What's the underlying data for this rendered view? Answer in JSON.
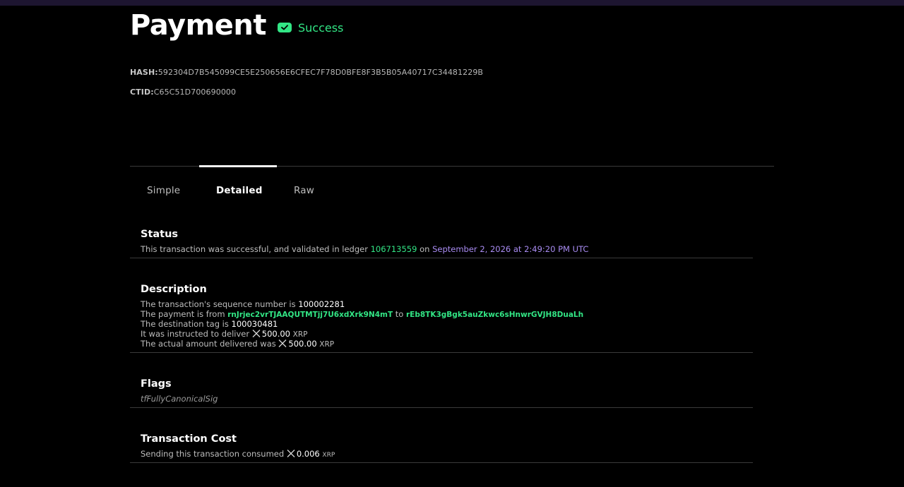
{
  "header": {
    "title": "Payment",
    "status": "Success",
    "hash_label": "HASH:",
    "hash_value": "592304D7B545099CE5E250656E6CFEC7F78D0BFE8F3B5B05A40717C34481229B",
    "ctid_label": "CTID:",
    "ctid_value": "C65C51D700690000"
  },
  "tabs": [
    {
      "label": "Simple",
      "active": false
    },
    {
      "label": "Detailed",
      "active": true
    },
    {
      "label": "Raw",
      "active": false
    }
  ],
  "status_section": {
    "title": "Status",
    "text_prefix": "This transaction was successful, and validated in ledger ",
    "ledger": "106713559",
    "text_mid": " on ",
    "date": "September 2, 2026 at 2:49:20 PM UTC"
  },
  "description_section": {
    "title": "Description",
    "line1_prefix": "The transaction's sequence number is ",
    "sequence": "100002281",
    "line2_prefix": "The payment is from ",
    "from_account": "rnJrjec2vrTJAAQUTMTjj7U6xdXrk9N4mT",
    "line2_mid": " to ",
    "to_account": "rEb8TK3gBgk5auZkwc6sHnwrGVJH8DuaLh",
    "line3_prefix": "The destination tag is ",
    "destination_tag": "100030481",
    "line4_prefix": "It was instructed to deliver ",
    "instructed_amount": "500.00",
    "instructed_currency": "XRP",
    "line5_prefix": "The actual amount delivered was ",
    "delivered_amount": "500.00",
    "delivered_currency": "XRP"
  },
  "flags_section": {
    "title": "Flags",
    "flag": "tfFullyCanonicalSig"
  },
  "cost_section": {
    "title": "Transaction Cost",
    "text_prefix": "Sending this transaction consumed ",
    "amount": "0.006",
    "currency": "XRP"
  },
  "colors": {
    "success": "#32e685",
    "date_link": "#a98cf2",
    "background": "#000000",
    "top_bar": "#1d1530"
  },
  "icons": {
    "status": "check-badge-icon",
    "currency": "xrp-logo-icon"
  }
}
